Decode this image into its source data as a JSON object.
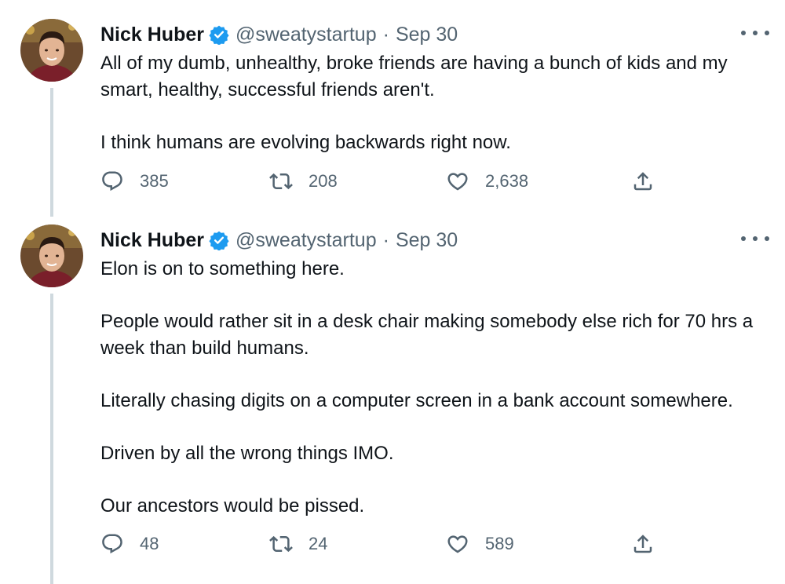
{
  "tweets": [
    {
      "author": {
        "name": "Nick Huber",
        "handle": "@sweatystartup",
        "verified": true
      },
      "separator": "·",
      "date": "Sep 30",
      "paragraphs": [
        "All of my dumb, unhealthy, broke friends are having a bunch of kids and my smart, healthy, successful friends aren't.",
        "I think humans are evolving backwards right now."
      ],
      "stats": {
        "replies": "385",
        "retweets": "208",
        "likes": "2,638"
      }
    },
    {
      "author": {
        "name": "Nick Huber",
        "handle": "@sweatystartup",
        "verified": true
      },
      "separator": "·",
      "date": "Sep 30",
      "paragraphs": [
        "Elon is on to something here.",
        "People would rather sit in a desk chair making somebody else rich for 70 hrs a week than build humans.",
        "Literally chasing digits on a computer screen in a bank account somewhere.",
        "Driven by all the wrong things IMO.",
        "Our ancestors would be pissed."
      ],
      "stats": {
        "replies": "48",
        "retweets": "24",
        "likes": "589"
      }
    }
  ],
  "icons": {
    "reply": "reply-icon",
    "retweet": "retweet-icon",
    "like": "heart-icon",
    "share": "share-icon",
    "more": "more-dots-icon",
    "verified": "verified-badge-icon"
  },
  "colors": {
    "verified": "#1d9bf0",
    "muted": "#536471",
    "thread_line": "#cfd9de",
    "text": "#0f1419"
  }
}
